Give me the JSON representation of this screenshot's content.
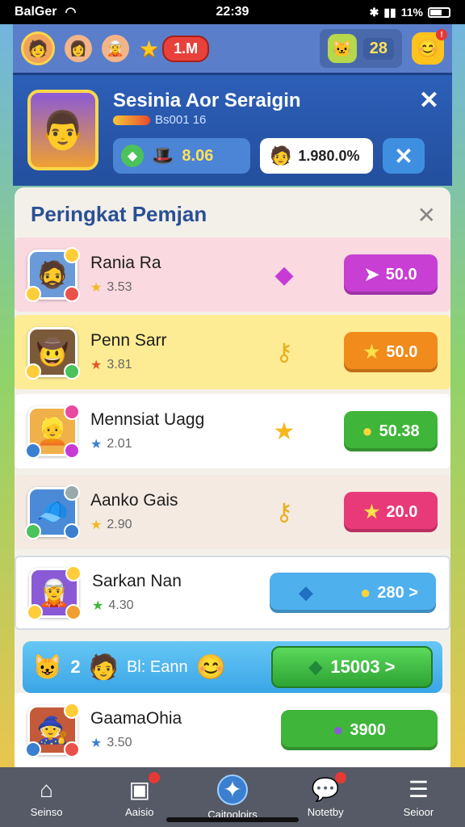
{
  "status_bar": {
    "carrier": "BalGer",
    "time": "22:39",
    "battery": "11%"
  },
  "top_bar": {
    "level_pill": "1.M",
    "resource_count": "28"
  },
  "profile": {
    "name": "Sesinia Aor Seraigin",
    "id_text": "Bs001 16",
    "stat_gold": "8.06",
    "stat_percent": "1.980.0%"
  },
  "leaderboard": {
    "title": "Peringkat Pemjan",
    "rows": [
      {
        "name": "Rania Ra",
        "score": "3.53",
        "reward": "50.0",
        "bg": "#fbd9e0",
        "btn": "#c83fd3"
      },
      {
        "name": "Penn Sarr",
        "score": "3.81",
        "reward": "50.0",
        "bg": "#fdec93",
        "btn": "#f08b1c"
      },
      {
        "name": "Mennsiat Uagg",
        "score": "2.01",
        "reward": "50.38",
        "bg": "#ffffff",
        "btn": "#3fb53a"
      },
      {
        "name": "Aanko Gais",
        "score": "2.90",
        "reward": "20.0",
        "bg": "#f4eae1",
        "btn": "#e83a78"
      },
      {
        "name": "Sarkan Nan",
        "score": "4.30",
        "reward": "280 >",
        "bg": "#ffffff",
        "btn": "#4fb0ee"
      },
      {
        "name": "GaamaOhia",
        "score": "3.50",
        "reward": "3900",
        "bg": "#ffffff",
        "btn": "#3fb53a"
      }
    ],
    "special": {
      "number": "2",
      "label": "Bl: Eann",
      "reward": "15003 >"
    }
  },
  "bottom_nav": [
    "Seinso",
    "Aaisio",
    "Caitooloirs",
    "Notetby",
    "Seioor"
  ],
  "colors": {
    "panel_title": "#2a4f94",
    "header_bg": "#2d5fb8"
  }
}
